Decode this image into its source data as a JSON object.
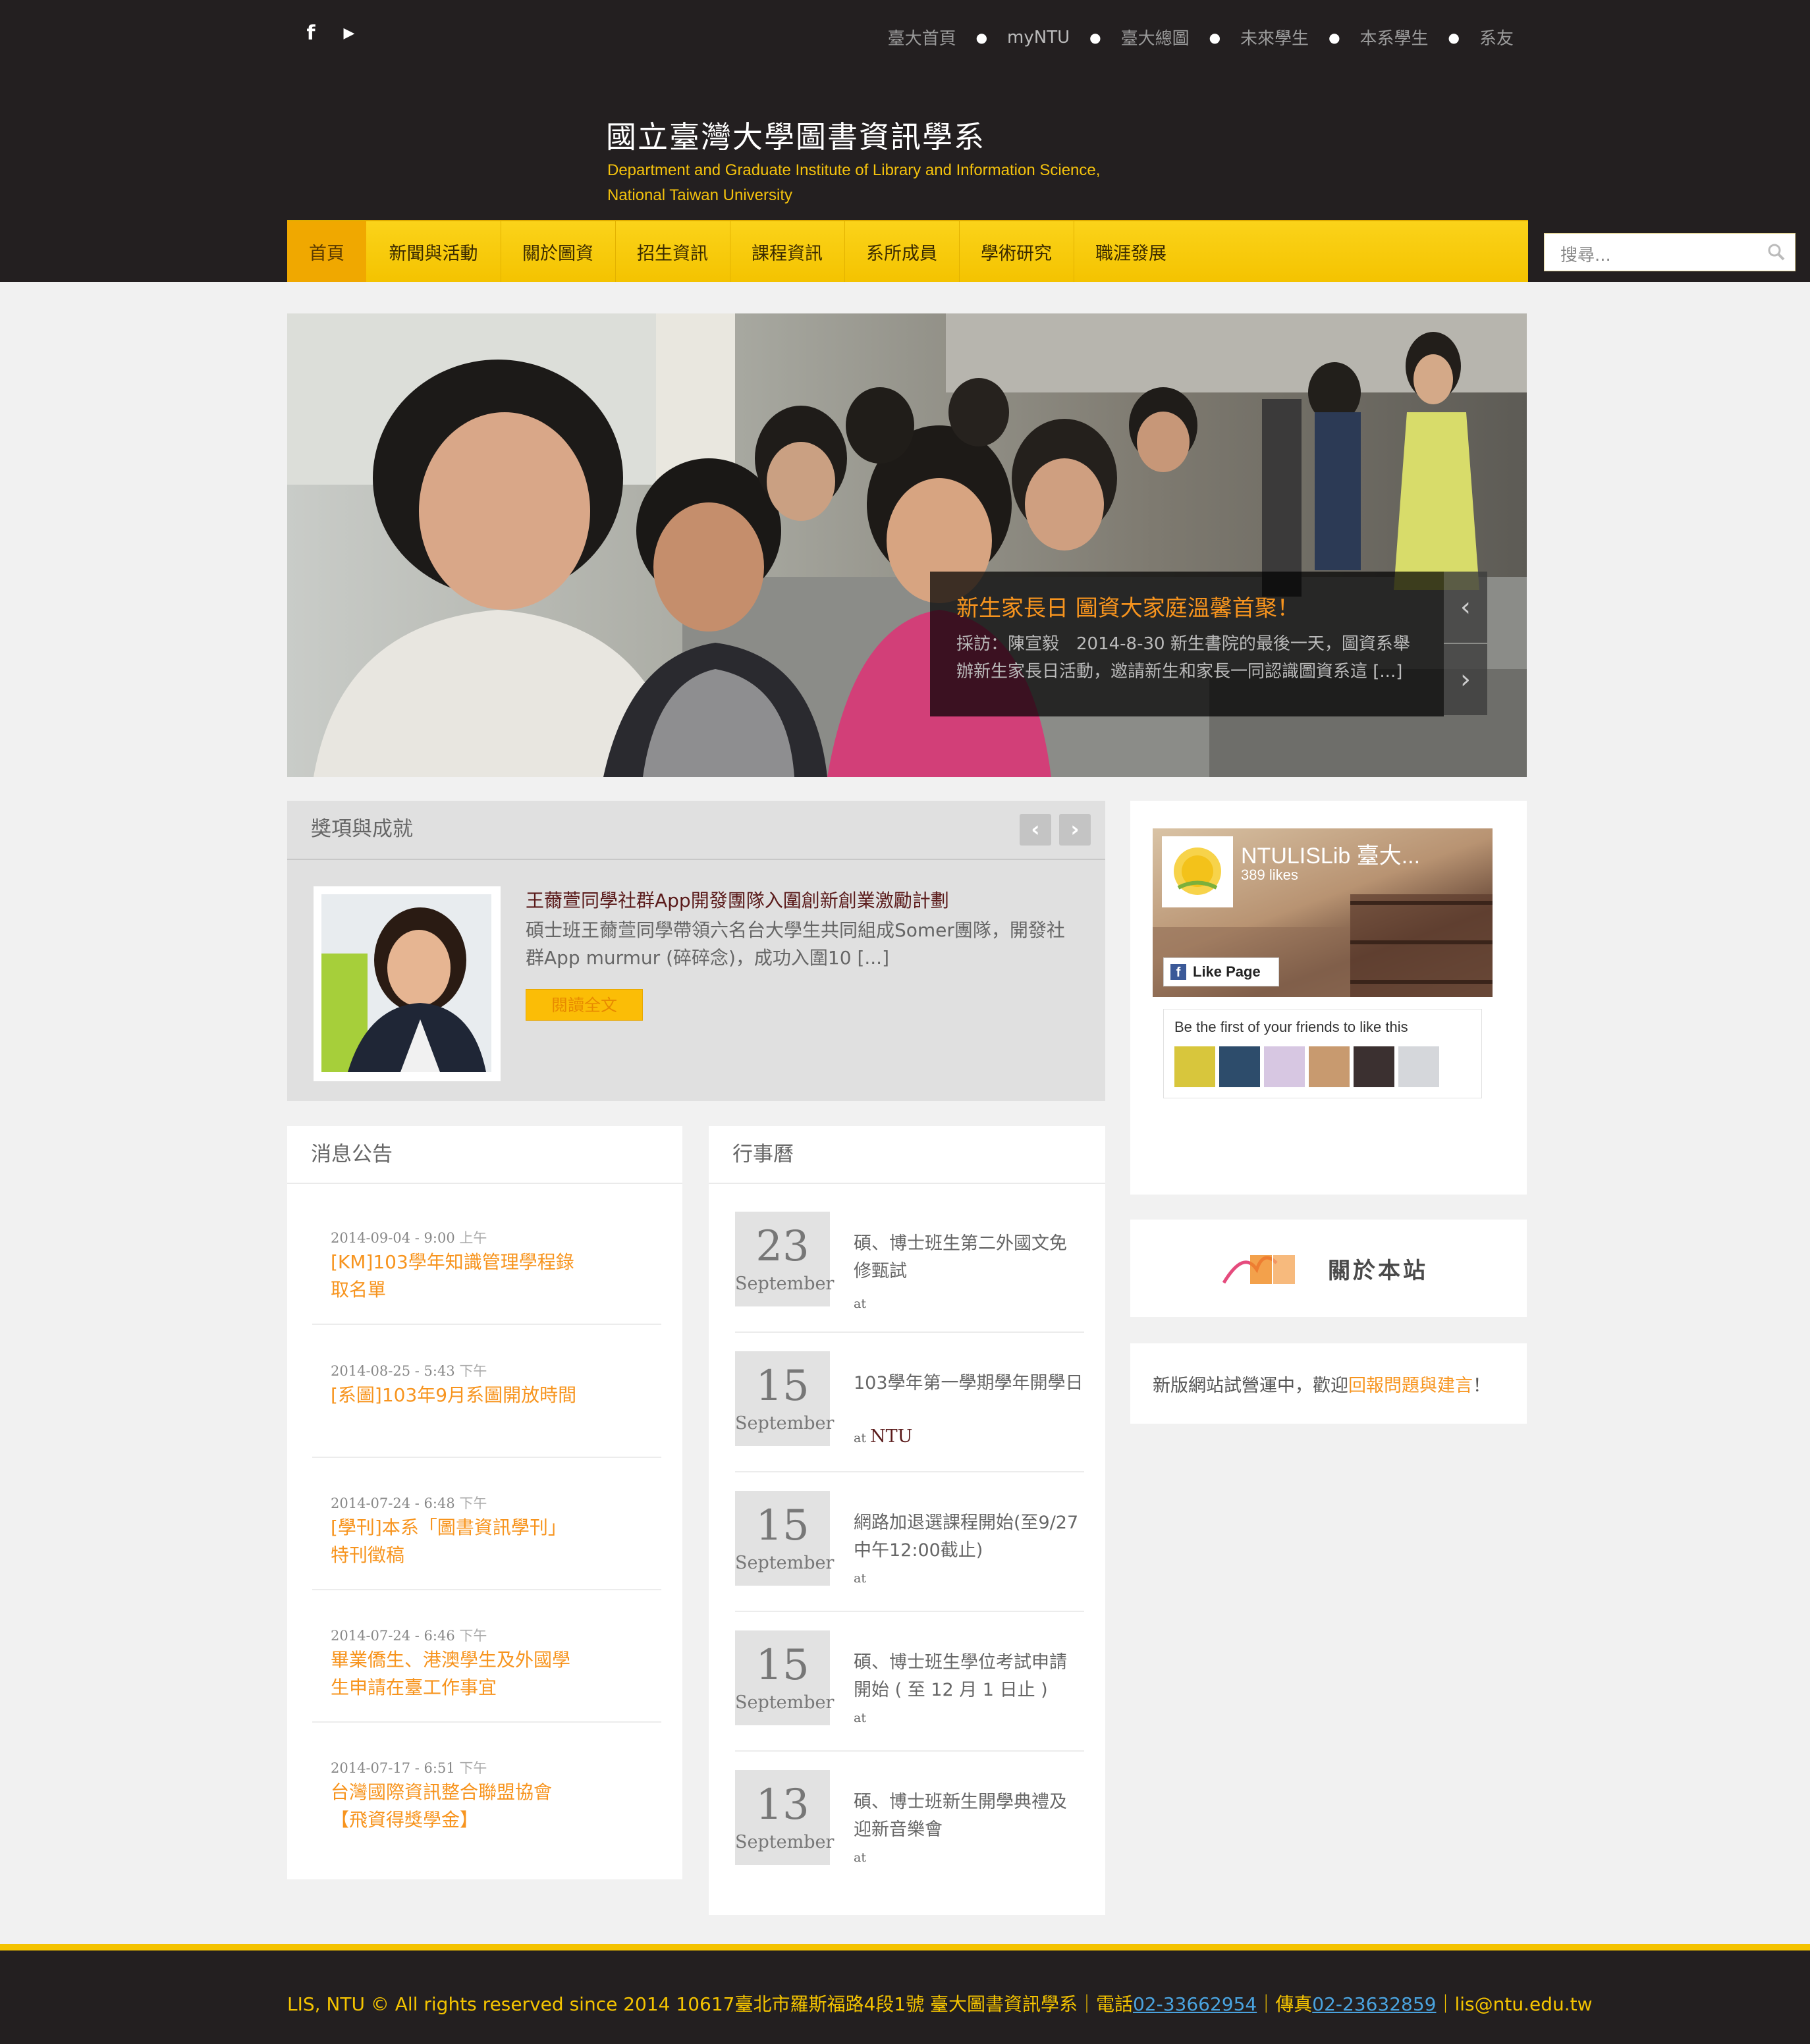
{
  "header": {
    "social": {
      "facebook": "f",
      "youtube": "▶"
    },
    "top_links": [
      "臺大首頁",
      "myNTU",
      "臺大總圖",
      "未來學生",
      "本系學生",
      "系友"
    ],
    "title": "國立臺灣大學圖書資訊學系",
    "subtitle_line1": "Department and Graduate Institute of Library and Information Science,",
    "subtitle_line2": "National Taiwan University"
  },
  "nav": {
    "items": [
      "首頁",
      "新聞與活動",
      "關於圖資",
      "招生資訊",
      "課程資訊",
      "系所成員",
      "學術研究",
      "職涯發展"
    ],
    "search_placeholder": "搜尋..."
  },
  "hero": {
    "title": "新生家長日 圖資大家庭溫馨首聚！",
    "text": "採訪：陳宣毅　2014-8-30 新生書院的最後一天，圖資系舉辦新生家長日活動，邀請新生和家長一同認識圖資系這 [...]",
    "prev": "‹",
    "next": "›"
  },
  "awards": {
    "heading": "獎項與成就",
    "prev": "‹",
    "next": "›",
    "title": "王薾萱同學社群App開發團隊入圍創新創業激勵計劃",
    "text": "碩士班王薾萱同學帶領六名台大學生共同組成Somer團隊，開發社群App murmur (碎碎念)，成功入圍10 [...]",
    "read_more": "閱讀全文"
  },
  "news": {
    "heading": "消息公告",
    "items": [
      {
        "date": "2014-09-04 - 9:00",
        "ampm": "上午",
        "title": "[KM]103學年知識管理學程錄取名單"
      },
      {
        "date": "2014-08-25 - 5:43",
        "ampm": "下午",
        "title": "[系圖]103年9月系圖開放時間"
      },
      {
        "date": "2014-07-24 - 6:48",
        "ampm": "下午",
        "title": "[學刊]本系「圖書資訊學刊」特刊徵稿"
      },
      {
        "date": "2014-07-24 - 6:46",
        "ampm": "下午",
        "title": "畢業僑生、港澳學生及外國學生申請在臺工作事宜"
      },
      {
        "date": "2014-07-17 - 6:51",
        "ampm": "下午",
        "title": "台灣國際資訊整合聯盟協會【飛資得獎學金】"
      }
    ]
  },
  "calendar": {
    "heading": "行事曆",
    "events": [
      {
        "day": "23",
        "month": "September",
        "title": "碩、博士班生第二外國文免修甄試",
        "at": "at",
        "place": ""
      },
      {
        "day": "15",
        "month": "September",
        "title": "103學年第一學期學年開學日",
        "at": "at",
        "place": "NTU"
      },
      {
        "day": "15",
        "month": "September",
        "title": "網路加退選課程開始(至9/27中午12:00截止)",
        "at": "at",
        "place": ""
      },
      {
        "day": "15",
        "month": "September",
        "title": "碩、博士班生學位考試申請開始 ( 至 12 月 1 日止 )",
        "at": "at",
        "place": ""
      },
      {
        "day": "13",
        "month": "September",
        "title": "碩、博士班新生開學典禮及迎新音樂會",
        "at": "at",
        "place": ""
      }
    ]
  },
  "facebook": {
    "name": "NTULISLib 臺大...",
    "likes": "389 likes",
    "like_button": "Like Page",
    "friends_text": "Be the first of your friends to like this"
  },
  "about": {
    "label": "關於本站"
  },
  "notice": {
    "prefix": "新版網站試營運中，歡迎",
    "link": "回報問題與建言",
    "suffix": "！"
  },
  "footer": {
    "text": "LIS, NTU © All rights reserved since 2014 10617臺北市羅斯福路4段1號 臺大圖書資訊學系｜電話",
    "phone": "02-33662954",
    "fax_label": "｜傳真",
    "fax": "02-23632859",
    "email": "｜lis@ntu.edu.tw"
  },
  "colors": {
    "header_bg": "#231f20",
    "nav_yellow": "#f4c300",
    "accent_orange": "#f7941e",
    "link_blue": "#4aa3df"
  }
}
